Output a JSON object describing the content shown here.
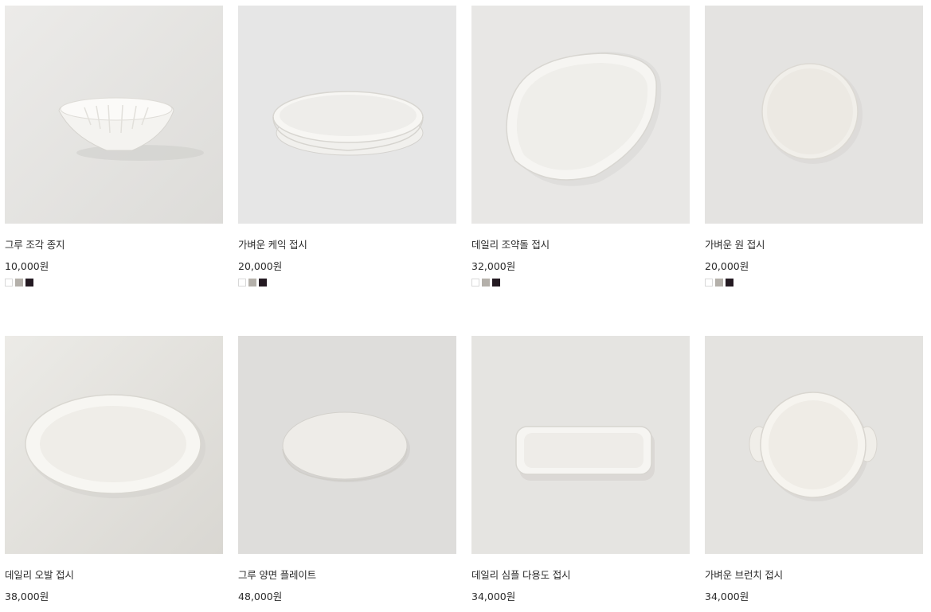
{
  "products": [
    {
      "name": "그루 조각 종지",
      "price": "10,000원",
      "swatch_colors": [
        "white",
        "gray",
        "black"
      ]
    },
    {
      "name": "가벼운 케익 접시",
      "price": "20,000원",
      "swatch_colors": [
        "white",
        "gray",
        "black"
      ]
    },
    {
      "name": "데일리 조약돌 접시",
      "price": "32,000원",
      "swatch_colors": [
        "white",
        "gray",
        "black"
      ]
    },
    {
      "name": "가벼운 원 접시",
      "price": "20,000원",
      "swatch_colors": [
        "white",
        "gray",
        "black"
      ]
    },
    {
      "name": "데일리 오발 접시",
      "price": "38,000원"
    },
    {
      "name": "그루 양면 플레이트",
      "price": "48,000원"
    },
    {
      "name": "데일리 심플 다용도 접시",
      "price": "34,000원"
    },
    {
      "name": "가벼운 브런치 접시",
      "price": "34,000원"
    }
  ],
  "colors": {
    "swatch_white": "#ffffff",
    "swatch_gray": "#b4b0aa",
    "swatch_black": "#241a22"
  }
}
